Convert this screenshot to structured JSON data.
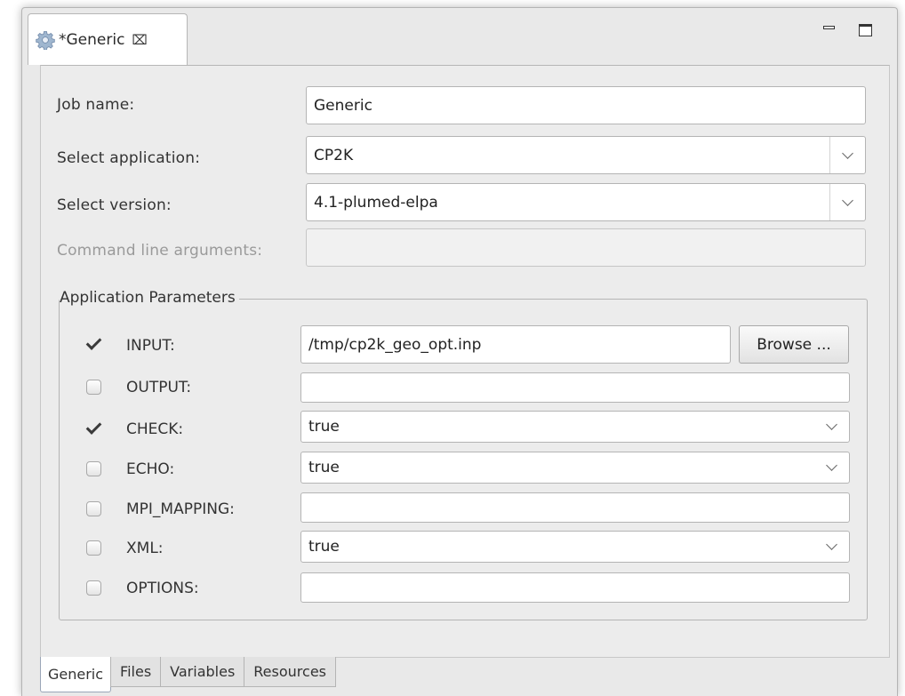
{
  "editor": {
    "tab_title": "*Generic",
    "close_glyph": "⌧",
    "icons": [
      "gear-icon",
      "close-icon",
      "minimize-icon",
      "maximize-icon"
    ]
  },
  "form": {
    "job_name_label": "Job name:",
    "job_name_value": "Generic",
    "app_label": "Select application:",
    "app_value": "CP2K",
    "version_label": "Select version:",
    "version_value": "4.1-plumed-elpa",
    "args_label": "Command line arguments:",
    "args_value": ""
  },
  "params": {
    "title": "Application Parameters",
    "browse_label": "Browse ...",
    "rows": [
      {
        "label": "INPUT:",
        "checked": true,
        "kind": "text",
        "value": "/tmp/cp2k_geo_opt.inp"
      },
      {
        "label": "OUTPUT:",
        "checked": false,
        "kind": "text",
        "value": ""
      },
      {
        "label": "CHECK:",
        "checked": true,
        "kind": "combo",
        "value": "true"
      },
      {
        "label": "ECHO:",
        "checked": false,
        "kind": "combo",
        "value": "true"
      },
      {
        "label": "MPI_MAPPING:",
        "checked": false,
        "kind": "text",
        "value": ""
      },
      {
        "label": "XML:",
        "checked": false,
        "kind": "combo",
        "value": "true"
      },
      {
        "label": "OPTIONS:",
        "checked": false,
        "kind": "text",
        "value": ""
      }
    ]
  },
  "bottom_tabs": [
    {
      "label": "Generic",
      "active": true
    },
    {
      "label": "Files",
      "active": false
    },
    {
      "label": "Variables",
      "active": false
    },
    {
      "label": "Resources",
      "active": false
    }
  ]
}
